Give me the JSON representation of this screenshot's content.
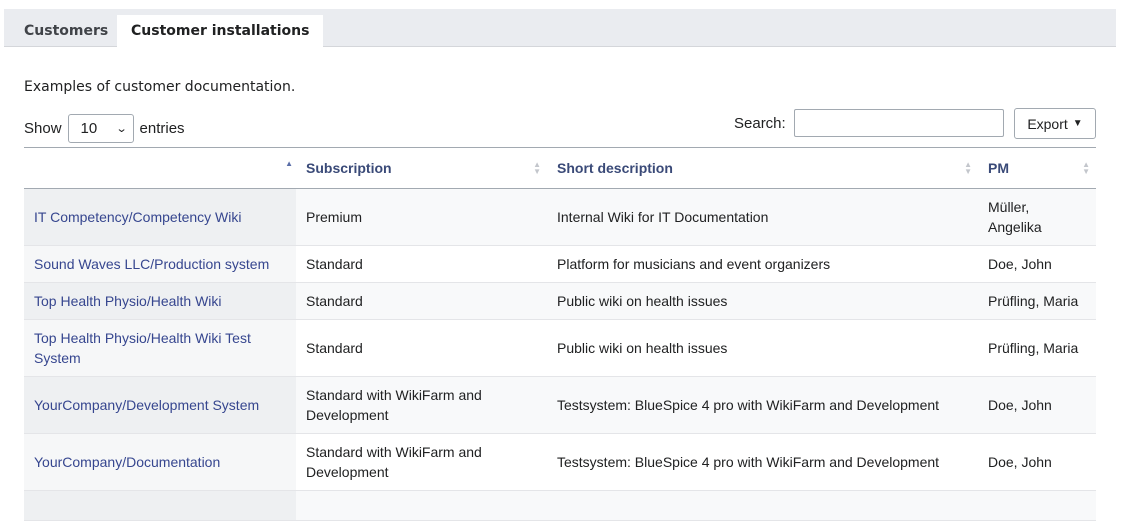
{
  "tabs": [
    {
      "label": "Customers"
    },
    {
      "label": "Customer installations"
    }
  ],
  "intro": "Examples of customer documentation.",
  "length_control": {
    "show_label": "Show",
    "value": "10",
    "entries_label": "entries"
  },
  "search": {
    "label": "Search:",
    "value": ""
  },
  "export": {
    "label": "Export"
  },
  "table": {
    "columns": [
      {
        "label": "",
        "sort": "asc"
      },
      {
        "label": "Subscription",
        "sort": "none"
      },
      {
        "label": "Short description",
        "sort": "none"
      },
      {
        "label": "PM",
        "sort": "none"
      }
    ],
    "rows": [
      {
        "name": "IT Competency/Competency Wiki",
        "subscription": "Premium",
        "description": "Internal Wiki for IT Documentation",
        "pm": "Müller, Angelika"
      },
      {
        "name": "Sound Waves LLC/Production system",
        "subscription": "Standard",
        "description": "Platform for musicians and event organizers",
        "pm": "Doe, John"
      },
      {
        "name": "Top Health Physio/Health Wiki",
        "subscription": "Standard",
        "description": "Public wiki on health issues",
        "pm": "Prüfling, Maria"
      },
      {
        "name": "Top Health Physio/Health Wiki Test System",
        "subscription": "Standard",
        "description": "Public wiki on health issues",
        "pm": "Prüfling, Maria"
      },
      {
        "name": "YourCompany/Development System",
        "subscription": "Standard with WikiFarm and Development",
        "description": "Testsystem: BlueSpice 4 pro with WikiFarm and Development",
        "pm": "Doe, John"
      },
      {
        "name": "YourCompany/Documentation",
        "subscription": "Standard with WikiFarm and Development",
        "description": "Testsystem: BlueSpice 4 pro with WikiFarm and Development",
        "pm": "Doe, John"
      }
    ]
  }
}
